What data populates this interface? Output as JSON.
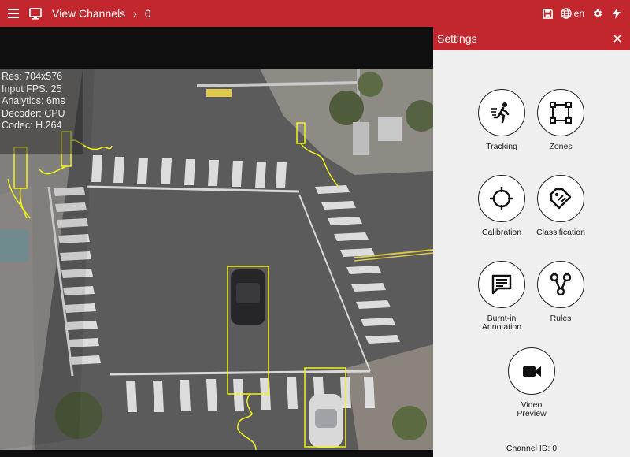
{
  "topbar": {
    "title": "View Channels",
    "separator": "›",
    "channel": "0",
    "language": "en",
    "background": "#c1272d"
  },
  "video": {
    "stats": [
      "Res: 704x576",
      "Input FPS: 25",
      "Analytics: 6ms",
      "Decoder: CPU",
      "Codec: H.264"
    ],
    "overlay_color": "#f2f21a"
  },
  "settings": {
    "title": "Settings",
    "tools": [
      {
        "label": "Tracking",
        "icon": "running-person-icon"
      },
      {
        "label": "Zones",
        "icon": "zone-square-icon"
      },
      {
        "label": "Calibration",
        "icon": "crosshair-icon"
      },
      {
        "label": "Classification",
        "icon": "tag-icon"
      },
      {
        "label": "Burnt-in\nAnnotation",
        "icon": "speech-bubble-icon"
      },
      {
        "label": "Rules",
        "icon": "rules-branch-icon"
      },
      {
        "label": "Video\nPreview",
        "icon": "video-camera-icon"
      }
    ],
    "channel_id": "Channel ID: 0"
  }
}
